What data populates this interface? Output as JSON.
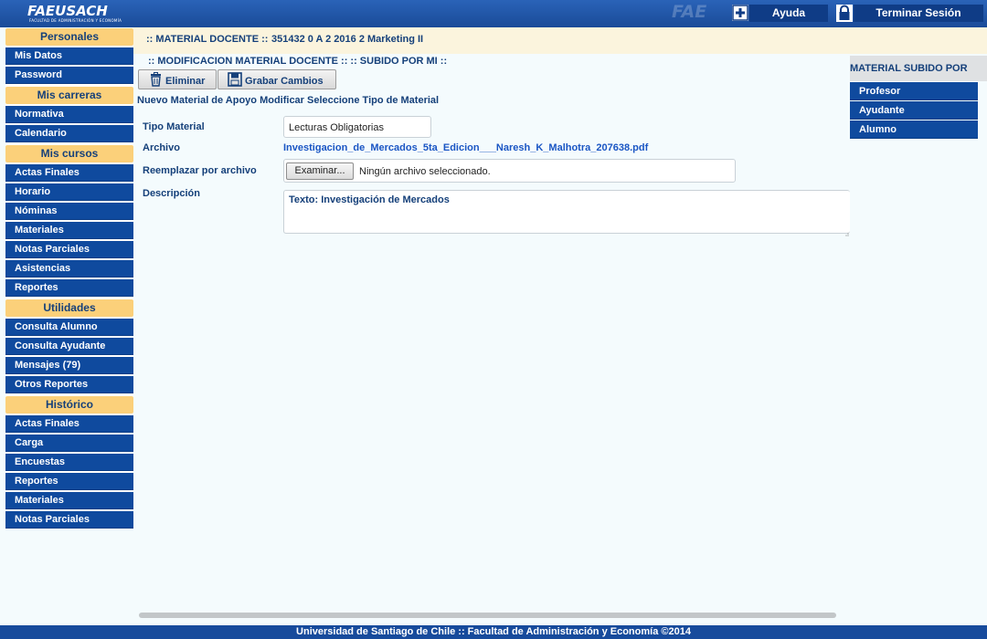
{
  "header": {
    "logo_text": "FAEUSACH",
    "logo_subtext": "FACULTAD DE ADMINISTRACIÓN Y ECONOMÍA",
    "help_label": "Ayuda",
    "logout_label": "Terminar Sesión"
  },
  "course_bar": {
    "label": ":: MATERIAL DOCENTE ::",
    "course": "351432 0 A 2 2016 2 Marketing II"
  },
  "sidebar": {
    "sections": [
      {
        "title": "Personales",
        "items": [
          "Mis Datos",
          "Password"
        ]
      },
      {
        "title": "Mis carreras",
        "items": [
          "Normativa",
          "Calendario"
        ]
      },
      {
        "title": "Mis cursos",
        "items": [
          "Actas Finales",
          "Horario",
          "Nóminas",
          "Materiales",
          "Notas Parciales",
          "Asistencias",
          "Reportes"
        ]
      },
      {
        "title": "Utilidades",
        "items": [
          "Consulta Alumno",
          "Consulta Ayudante",
          "Mensajes (79)",
          "Otros Reportes"
        ]
      },
      {
        "title": "Histórico",
        "items": [
          "Actas Finales",
          "Carga",
          "Encuestas",
          "Reportes",
          "Materiales",
          "Notas Parciales"
        ]
      }
    ]
  },
  "main": {
    "breadcrumb": ":: MODIFICACION MATERIAL DOCENTE :: :: SUBIDO POR MI ::",
    "delete_label": "Eliminar",
    "save_label": "Grabar Cambios",
    "description_line": "Nuevo Material de Apoyo Modificar Seleccione Tipo de Material",
    "form": {
      "tipo_label": "Tipo Material",
      "tipo_value": "Lecturas Obligatorias",
      "archivo_label": "Archivo",
      "archivo_value": "Investigacion_de_Mercados_5ta_Edicion___Naresh_K_Malhotra_207638.pdf",
      "reemplazar_label": "Reemplazar por archivo",
      "browse_label": "Examinar...",
      "no_file_text": "Ningún archivo seleccionado.",
      "descripcion_label": "Descripción",
      "descripcion_value": "Texto: Investigación de Mercados"
    }
  },
  "right_panel": {
    "title": "MATERIAL SUBIDO POR",
    "items": [
      "Profesor",
      "Ayudante",
      "Alumno"
    ]
  },
  "footer": {
    "text": "Universidad de Santiago de Chile :: Facultad de Administración y Economía ©2014"
  },
  "colors": {
    "nav_blue": "#0f4a9e",
    "section_header": "#fbd07a",
    "page_bg": "#f4fbfd",
    "text_blue": "#15407a"
  }
}
